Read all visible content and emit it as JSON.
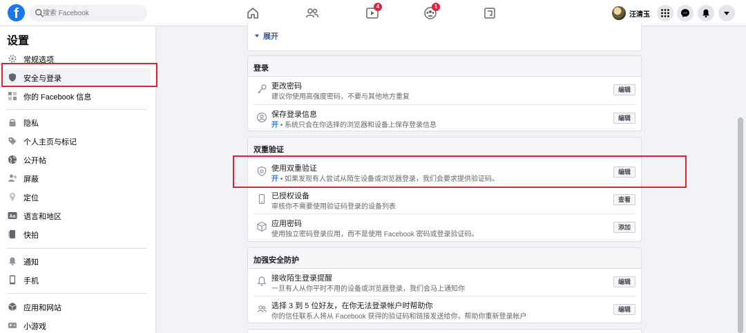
{
  "header": {
    "logo_letter": "f",
    "search_placeholder": "搜索 Facebook",
    "video_badge": "4",
    "groups_badge": "1",
    "profile_name": "汪清玉"
  },
  "sidebar": {
    "title": "设置",
    "items": [
      {
        "label": "常规选项",
        "icon": "gear-icon"
      },
      {
        "label": "安全与登录",
        "icon": "shield-icon",
        "active": true
      },
      {
        "label": "你的 Facebook 信息",
        "icon": "facebook-info-icon"
      },
      {
        "label": "隐私",
        "icon": "lock-icon"
      },
      {
        "label": "个人主页与标记",
        "icon": "tag-icon"
      },
      {
        "label": "公开帖",
        "icon": "globe-icon"
      },
      {
        "label": "屏蔽",
        "icon": "block-user-icon"
      },
      {
        "label": "定位",
        "icon": "location-pin-icon"
      },
      {
        "label": "语言和地区",
        "icon": "language-icon"
      },
      {
        "label": "快拍",
        "icon": "stories-icon"
      },
      {
        "label": "通知",
        "icon": "bell-icon"
      },
      {
        "label": "手机",
        "icon": "phone-icon"
      },
      {
        "label": "应用和网站",
        "icon": "apps-cube-icon"
      },
      {
        "label": "小游戏",
        "icon": "game-controller-icon"
      }
    ]
  },
  "main": {
    "expand_label": "展开",
    "login": {
      "title": "登录",
      "rows": [
        {
          "title": "更改密码",
          "desc": "建议你使用高强度密码，不要与其他地方重复",
          "button": "编辑"
        },
        {
          "title": "保存登录信息",
          "status": "开",
          "desc": " • 系统只会在你选择的浏览器和设备上保存登录信息",
          "button": "编辑"
        }
      ]
    },
    "two_factor": {
      "title": "双重验证",
      "rows": [
        {
          "title": "使用双重验证",
          "status": "开",
          "desc": " • 如果发现有人尝试从陌生设备或浏览器登录，我们会要求提供验证码。",
          "button": "编辑"
        },
        {
          "title": "已授权设备",
          "desc": "审核你不需要使用验证码登录的设备列表",
          "button": "查看"
        },
        {
          "title": "应用密码",
          "desc": "使用独立密码登录应用，而不是使用 Facebook 密码或登录验证码。",
          "button": "添加"
        }
      ]
    },
    "extra_security": {
      "title": "加强安全防护",
      "rows": [
        {
          "title": "接收陌生登录提醒",
          "desc": "一旦有人从你平时不用的设备或浏览器登录，我们会马上通知你",
          "button": "编辑"
        },
        {
          "title": "选择 3 到 5 位好友，在你无法登录帐户时帮助你",
          "desc": "你的信任联系人将从 Facebook 获得的验证码和链接发送给你，帮助你重新登录帐户",
          "button": "编辑"
        }
      ]
    }
  }
}
